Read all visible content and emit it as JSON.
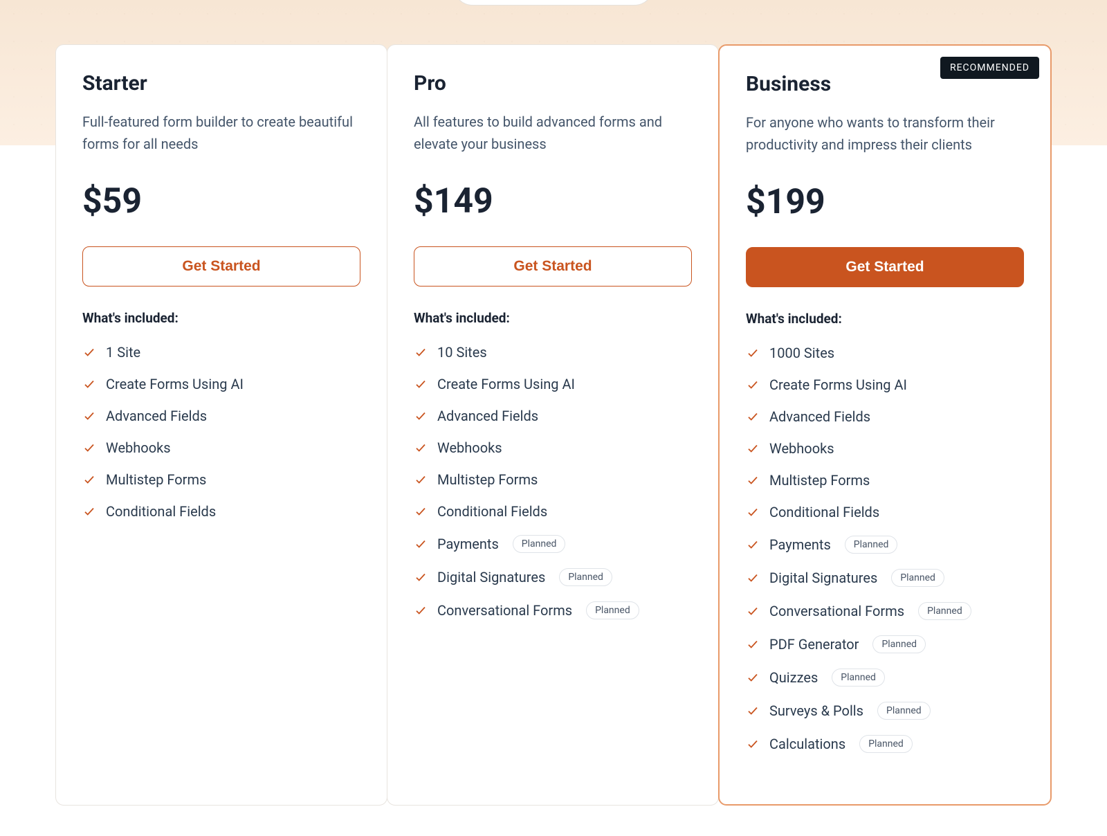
{
  "badges": {
    "recommended": "RECOMMENDED",
    "planned": "Planned"
  },
  "labels": {
    "included": "What's included:"
  },
  "plans": {
    "starter": {
      "name": "Starter",
      "desc": "Full-featured form builder to create beautiful forms for all needs",
      "price": "$59",
      "cta": "Get Started",
      "features": {
        "f0": "1 Site",
        "f1": "Create Forms Using AI",
        "f2": "Advanced Fields",
        "f3": "Webhooks",
        "f4": "Multistep Forms",
        "f5": "Conditional Fields"
      }
    },
    "pro": {
      "name": "Pro",
      "desc": "All features to build advanced forms and elevate your business",
      "price": "$149",
      "cta": "Get Started",
      "features": {
        "f0": "10 Sites",
        "f1": "Create Forms Using AI",
        "f2": "Advanced Fields",
        "f3": "Webhooks",
        "f4": "Multistep Forms",
        "f5": "Conditional Fields",
        "f6": "Payments",
        "f7": "Digital Signatures",
        "f8": "Conversational Forms"
      }
    },
    "business": {
      "name": "Business",
      "desc": "For anyone who wants to transform their productivity and impress their clients",
      "price": "$199",
      "cta": "Get Started",
      "features": {
        "f0": "1000 Sites",
        "f1": "Create Forms Using AI",
        "f2": "Advanced Fields",
        "f3": "Webhooks",
        "f4": "Multistep Forms",
        "f5": "Conditional Fields",
        "f6": "Payments",
        "f7": "Digital Signatures",
        "f8": "Conversational Forms",
        "f9": "PDF Generator",
        "f10": "Quizzes",
        "f11": "Surveys & Polls",
        "f12": "Calculations"
      }
    }
  }
}
